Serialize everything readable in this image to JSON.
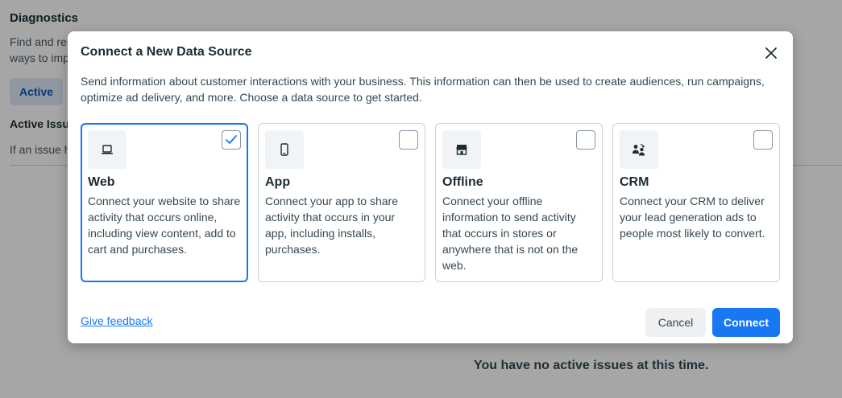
{
  "background": {
    "title": "Diagnostics",
    "description": "Find and res ways to imp",
    "tab_active": "Active",
    "subtitle": "Active Issu",
    "note": "If an issue h",
    "empty_message": "You have no active issues at this time."
  },
  "modal": {
    "title": "Connect a New Data Source",
    "description": "Send information about customer interactions with your business. This information can then be used to create audiences, run campaigns, optimize ad delivery, and more. Choose a data source to get started.",
    "cards": [
      {
        "title": "Web",
        "text": "Connect your website to share activity that occurs online, including view content, add to cart and purchases.",
        "icon": "laptop-icon",
        "selected": true
      },
      {
        "title": "App",
        "text": "Connect your app to share activity that occurs in your app, including installs, purchases.",
        "icon": "phone-icon",
        "selected": false
      },
      {
        "title": "Offline",
        "text": "Connect your offline information to send activity that occurs in stores or anywhere that is not on the web.",
        "icon": "store-icon",
        "selected": false
      },
      {
        "title": "CRM",
        "text": "Connect your CRM to deliver your lead generation ads to people most likely to convert.",
        "icon": "crm-people-icon",
        "selected": false
      }
    ],
    "feedback_link": "Give feedback",
    "cancel_label": "Cancel",
    "connect_label": "Connect"
  },
  "colors": {
    "accent": "#1877f2",
    "overlay": "rgba(0,0,0,0.35)"
  }
}
